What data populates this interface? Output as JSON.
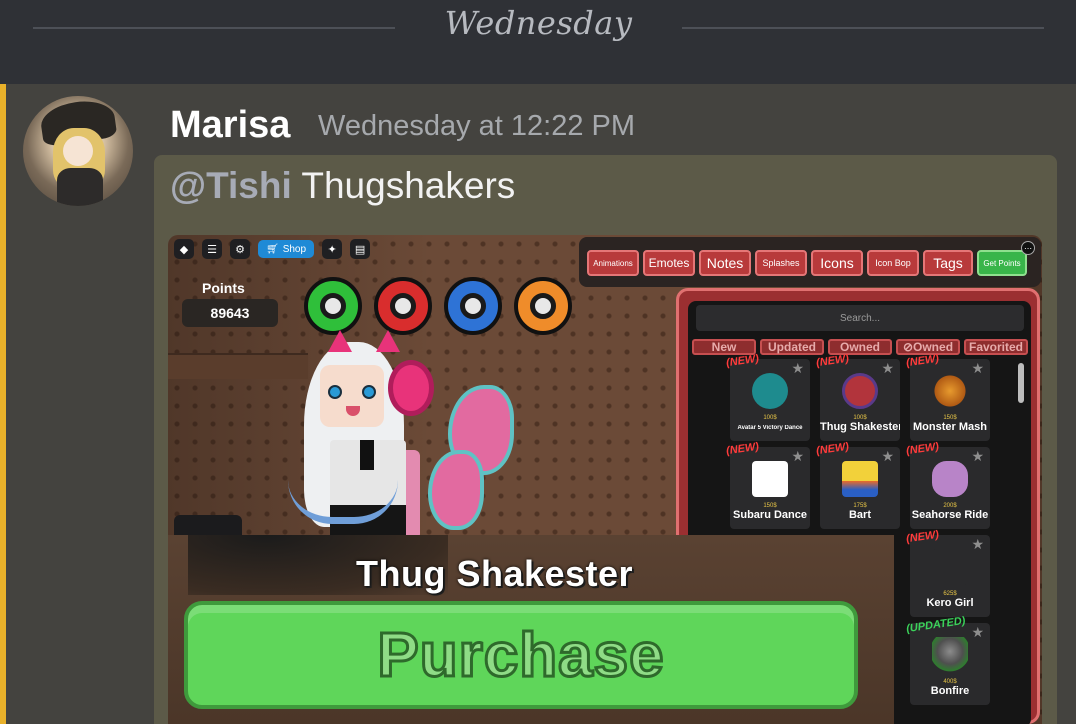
{
  "divider": {
    "label": "Wednesday"
  },
  "message": {
    "author": "Marisa",
    "timestamp": "Wednesday at 12:22 PM",
    "mention": "@Tishi",
    "text": "Thugshakers",
    "accent_color": "#e9b12a"
  },
  "game": {
    "topbar": {
      "shop_label": "Shop"
    },
    "points": {
      "label": "Points",
      "value": "89643"
    },
    "rings": [
      "green",
      "red",
      "blue",
      "orange"
    ],
    "tabs": [
      {
        "label": "Animations"
      },
      {
        "label": "Emotes"
      },
      {
        "label": "Notes"
      },
      {
        "label": "Splashes"
      },
      {
        "label": "Icons"
      },
      {
        "label": "Icon Bop"
      },
      {
        "label": "Tags"
      },
      {
        "label": "Get Points"
      }
    ],
    "search_placeholder": "Search...",
    "filters": [
      {
        "label": "New"
      },
      {
        "label": "Updated"
      },
      {
        "label": "Owned"
      },
      {
        "label": "Owned"
      },
      {
        "label": "Favorited"
      }
    ],
    "items": [
      {
        "badge": "(NEW)",
        "price": "100$",
        "name": "Avatar 5 Victory Dance"
      },
      {
        "badge": "(NEW)",
        "price": "100$",
        "name": "Thug Shakester"
      },
      {
        "badge": "(NEW)",
        "price": "150$",
        "name": "Monster Mash"
      },
      {
        "badge": "(NEW)",
        "price": "150$",
        "name": "Subaru Dance"
      },
      {
        "badge": "(NEW)",
        "price": "175$",
        "name": "Bart"
      },
      {
        "badge": "(NEW)",
        "price": "200$",
        "name": "Seahorse Ride"
      },
      {
        "badge": "(NEW)",
        "price": "625$",
        "name": "Kero Girl"
      },
      {
        "badge": "(UPDATED)",
        "price": "400$",
        "name": "Bonfire"
      }
    ],
    "overlay": {
      "title": "Thug Shakester",
      "button": "Purchase"
    }
  }
}
